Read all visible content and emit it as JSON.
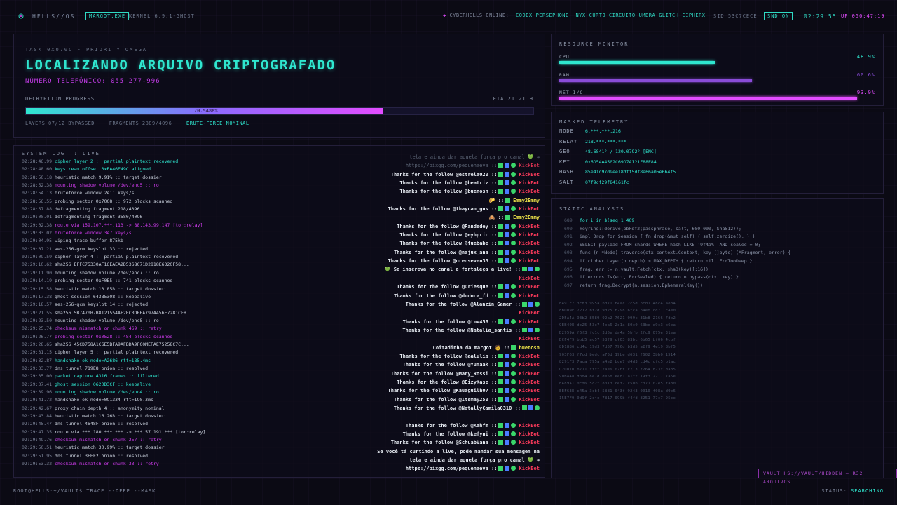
{
  "topbar": {
    "brand": "HELLS//OS",
    "machine": "MARGOT.EXE",
    "kernel": "KERNEL 6.9.1-GHOST",
    "online_label": "CYBERHELLS ONLINE:",
    "online_users": [
      "CODEX",
      "PERSEPHONE_",
      "NYX",
      "CURTO_CIRCUITO",
      "UMBRA",
      "GLITCH",
      "CIPHERX"
    ],
    "sid": "SID 53C7CECE",
    "snd": "SND ON",
    "clock": "02:29:55",
    "uptime": "UP 050:47:19"
  },
  "task": {
    "id": "TASK 0X070C - PRIORITY OMEGA",
    "title": "LOCALIZANDO ARQUIVO CRIPTOGRAFADO",
    "phone": "NÚMERO TELEFÔNICO: 055 277-996",
    "progress_label": "DECRYPTION PROGRESS",
    "eta": "ETA 21.21 H",
    "progress": 0.705,
    "progress_text": "70.5488%",
    "layers": "LAYERS 07/12 BYPASSED",
    "fragments": "FRAGMENTS 2889/4096",
    "bruteforce": "BRUTE-FORCE NOMINAL"
  },
  "syslog": {
    "title": "SYSTEM LOG :: LIVE",
    "lines": [
      {
        "ts": "02:28:46.99",
        "text": "cipher layer 2 :: partial plaintext recovered",
        "color": "cyan"
      },
      {
        "ts": "02:28:48.60",
        "text": "keystream offset 0xEA46E49C aligned",
        "color": "cyan"
      },
      {
        "ts": "02:28:50.18",
        "text": "heuristic match 9.91% :: target dossier",
        "color": "white"
      },
      {
        "ts": "02:28:52.38",
        "text": "mounting shadow volume /dev/enc5 :: ro",
        "color": "mag"
      },
      {
        "ts": "02:28:54.13",
        "text": "bruteforce window 2e11 keys/s",
        "color": "white"
      },
      {
        "ts": "02:28:56.55",
        "text": "probing sector 0x70C8 :: 972 blocks scanned",
        "color": "white"
      },
      {
        "ts": "02:28:57.88",
        "text": "defragmenting fragment 218/4096",
        "color": "white"
      },
      {
        "ts": "02:29:00.01",
        "text": "defragmenting fragment 3580/4096",
        "color": "white"
      },
      {
        "ts": "02:29:02.38",
        "text": "route via 159.107.***.113 -> 88.143.99.147 [tor:relay]",
        "color": "mag"
      },
      {
        "ts": "02:29:03.02",
        "text": "bruteforce window 3e7 keys/s",
        "color": "mag"
      },
      {
        "ts": "02:29:04.95",
        "text": "wiping trace buffer 875kb",
        "color": "white"
      },
      {
        "ts": "02:29:07.21",
        "text": "aes-256-gcm keyslot 33 :: rejected",
        "color": "white"
      },
      {
        "ts": "02:29:09.59",
        "text": "cipher layer 4 :: partial plaintext recovered",
        "color": "white"
      },
      {
        "ts": "02:29:10.62",
        "text": "sha256 EFFC75330AF16EAEA2D5368C71D2818E6D20F58...",
        "color": "white"
      },
      {
        "ts": "02:29:11.90",
        "text": "mounting shadow volume /dev/enc7 :: ro",
        "color": "white"
      },
      {
        "ts": "02:29:14.19",
        "text": "probing sector 0xF0E5 :: 741 blocks scanned",
        "color": "white"
      },
      {
        "ts": "02:29:15.58",
        "text": "heuristic match 13.85% :: target dossier",
        "color": "white"
      },
      {
        "ts": "02:29:17.38",
        "text": "ghost session 64385308 :: keepalive",
        "color": "white"
      },
      {
        "ts": "02:29:18.57",
        "text": "aes-256-gcm keyslot 14 :: rejected",
        "color": "white"
      },
      {
        "ts": "02:29:21.55",
        "text": "sha256 5B7470B7B8121554AF2EC3DBEA797A456F7281CEB...",
        "color": "white"
      },
      {
        "ts": "02:29:23.50",
        "text": "mounting shadow volume /dev/enc8 :: ro",
        "color": "white"
      },
      {
        "ts": "02:29:25.74",
        "text": "checksum mismatch on chunk 469 :: retry",
        "color": "mag"
      },
      {
        "ts": "02:29:26.77",
        "text": "probing sector 0x0528 :: 484 blocks scanned",
        "color": "mag"
      },
      {
        "ts": "02:29:28.65",
        "text": "sha256 45CD758A1C6E5BFA9AFBDA9FC0MEFAE75258C7C...",
        "color": "white"
      },
      {
        "ts": "02:29:31.15",
        "text": "cipher layer 5 :: partial plaintext recovered",
        "color": "white"
      },
      {
        "ts": "02:29:32.87",
        "text": "handshake ok node=A2686 rtt=185.4ms",
        "color": "cyan"
      },
      {
        "ts": "02:29:33.77",
        "text": "dns tunnel 719E8.onion :: resolved",
        "color": "white"
      },
      {
        "ts": "02:29:35.00",
        "text": "packet capture 4316 frames :: filtered",
        "color": "cyan"
      },
      {
        "ts": "02:29:37.41",
        "text": "ghost session 0620D3CF :: keepalive",
        "color": "cyan"
      },
      {
        "ts": "02:29:39.96",
        "text": "mounting shadow volume /dev/enc4 :: ro",
        "color": "cyan"
      },
      {
        "ts": "02:29:41.72",
        "text": "handshake ok node=0C1334 rtt=190.3ms",
        "color": "white"
      },
      {
        "ts": "02:29:42.67",
        "text": "proxy chain depth 4 :: anonymity nominal",
        "color": "white"
      },
      {
        "ts": "02:29:43.84",
        "text": "heuristic match 16.26% :: target dossier",
        "color": "white"
      },
      {
        "ts": "02:29:45.47",
        "text": "dns tunnel 4648F.onion :: resolved",
        "color": "white"
      },
      {
        "ts": "02:29:47.35",
        "text": "route via ***.180.***.*** -> ***.57.191.*** [tor:relay]",
        "color": "white"
      },
      {
        "ts": "02:29:49.76",
        "text": "checksum mismatch on chunk 257 :: retry",
        "color": "mag"
      },
      {
        "ts": "02:29:50.51",
        "text": "heuristic match 30.99% :: target dossier",
        "color": "white"
      },
      {
        "ts": "02:29:51.95",
        "text": "dns tunnel 3FEF2.onion :: resolved",
        "color": "white"
      },
      {
        "ts": "02:29:53.32",
        "text": "checksum mismatch on chunk 33 :: retry",
        "color": "mag"
      }
    ]
  },
  "chat": [
    {
      "text": "tela e ainda dar aquela força pro canal 💚 →",
      "nick": "",
      "faded": true,
      "icons": 0
    },
    {
      "text": "https://pixgg.com/pequenaeva ::",
      "nick": "KickBot",
      "faded": true,
      "icons": 3
    },
    {
      "text": "Thanks for the follow @estrela020 ::",
      "nick": "KickBot",
      "faded": false,
      "icons": 3
    },
    {
      "text": "Thanks for the follow @beatriz ::",
      "nick": "KickBot",
      "faded": false,
      "icons": 3
    },
    {
      "text": "Thanks for the follow @buenosn ::",
      "nick": "KickBot",
      "faded": false,
      "icons": 3
    },
    {
      "text": "🌮 ::",
      "nick": "Emmy2Emmy",
      "faded": false,
      "icons": 1,
      "nickColor": "yel"
    },
    {
      "text": "Thanks for the follow @thaynan_gus ::",
      "nick": "KickBot",
      "faded": false,
      "icons": 3
    },
    {
      "text": "🙈 ::",
      "nick": "Emmy2Emmy",
      "faded": false,
      "icons": 1,
      "nickColor": "yel"
    },
    {
      "text": "Thanks for the follow @Pandedey ::",
      "nick": "KickBot",
      "faded": false,
      "icons": 3
    },
    {
      "text": "Thanks for the follow @eyhpric ::",
      "nick": "KickBot",
      "faded": false,
      "icons": 3
    },
    {
      "text": "Thanks for the follow @fuebabe ::",
      "nick": "KickBot",
      "faded": false,
      "icons": 3
    },
    {
      "text": "Thanks for the follow @najux_ana ::",
      "nick": "KickBot",
      "faded": false,
      "icons": 3
    },
    {
      "text": "Thanks for the follow @oreoseven33 ::",
      "nick": "KickBot",
      "faded": false,
      "icons": 3
    },
    {
      "text": "💚 Se inscreva no canal e fortaleça a live! ::",
      "nick": "",
      "faded": false,
      "icons": 3
    },
    {
      "text": "",
      "nick": "KickBot",
      "faded": false,
      "icons": 0
    },
    {
      "text": "Thanks for the follow @Driesque ::",
      "nick": "KickBot",
      "faded": false,
      "icons": 3
    },
    {
      "text": "Thanks for the follow @dudoca_fd ::",
      "nick": "KickBot",
      "faded": false,
      "icons": 3
    },
    {
      "text": "Thanks for the follow @Alanzin_Gamer ::",
      "nick": "",
      "faded": false,
      "icons": 3
    },
    {
      "text": "",
      "nick": "KickBot",
      "faded": false,
      "icons": 0
    },
    {
      "text": "Thanks for the follow @tmv456 ::",
      "nick": "KickBot",
      "faded": false,
      "icons": 3
    },
    {
      "text": "Thanks for the follow @Natalia_santis ::",
      "nick": "",
      "faded": false,
      "icons": 3
    },
    {
      "text": "",
      "nick": "KickBot",
      "faded": false,
      "icons": 0
    },
    {
      "text": "Coitadinha da margot 🧑 ::",
      "nick": "buenosn",
      "faded": false,
      "icons": 1,
      "nickColor": "yel"
    },
    {
      "text": "Thanks for the follow @aalulia ::",
      "nick": "KickBot",
      "faded": false,
      "icons": 3
    },
    {
      "text": "Thanks for the follow @Yumaak ::",
      "nick": "KickBot",
      "faded": false,
      "icons": 3
    },
    {
      "text": "Thanks for the follow @Mary_Rossi ::",
      "nick": "KickBot",
      "faded": false,
      "icons": 3
    },
    {
      "text": "Thanks for the follow @EizyKase ::",
      "nick": "KickBot",
      "faded": false,
      "icons": 3
    },
    {
      "text": "Thanks for the follow @Kauaguilh07 ::",
      "nick": "KickBot",
      "faded": false,
      "icons": 3
    },
    {
      "text": "Thanks for the follow @Itsmay250 ::",
      "nick": "KickBot",
      "faded": false,
      "icons": 3
    },
    {
      "text": "Thanks for the follow @NatallyCamila0310 ::",
      "nick": "",
      "faded": false,
      "icons": 3
    },
    {
      "text": "",
      "nick": "",
      "faded": false,
      "icons": 0
    },
    {
      "text": "Thanks for the follow @Kahfm ::",
      "nick": "KickBot",
      "faded": false,
      "icons": 3
    },
    {
      "text": "Thanks for the follow @kefyni ::",
      "nick": "KickBot",
      "faded": false,
      "icons": 3
    },
    {
      "text": "Thanks for the follow @SchuabVana ::",
      "nick": "KickBot",
      "faded": false,
      "icons": 3
    },
    {
      "text": "Se você tá curtindo a live, pode mandar sua mensagem na",
      "nick": "",
      "faded": false,
      "icons": 0
    },
    {
      "text": "tela e ainda dar aquela força pro canal 💚 →",
      "nick": "",
      "faded": false,
      "icons": 0
    },
    {
      "text": "https://pixgg.com/pequenaeva ::",
      "nick": "KickBot",
      "faded": false,
      "icons": 3
    }
  ],
  "resource_monitor": {
    "title": "RESOURCE MONITOR",
    "items": [
      {
        "label": "CPU",
        "value": "48.9%",
        "fraction": 0.489,
        "color": "#2fe6cf"
      },
      {
        "label": "RAM",
        "value": "60.6%",
        "fraction": 0.606,
        "color": "#8a4cd8"
      },
      {
        "label": "NET I/O",
        "value": "93.9%",
        "fraction": 0.939,
        "color": "#e34cff"
      }
    ]
  },
  "telemetry": {
    "title": "MASKED TELEMETRY",
    "rows": [
      {
        "key": "NODE",
        "value": "6.***.***.216"
      },
      {
        "key": "RELAY",
        "value": "218.***.***.***"
      },
      {
        "key": "GEO",
        "value": "48.6841° / 120.0792° [ENC]"
      },
      {
        "key": "KEY",
        "value": "0x6D54A4502C69D7A121F88E84"
      },
      {
        "key": "HASH",
        "value": "85e41d97d9ee18dff5df8e66a05e664f5"
      },
      {
        "key": "SALT",
        "value": "07f9cf29f84161fc"
      }
    ]
  },
  "static_analysis": {
    "title": "STATIC ANALYSIS",
    "code": [
      {
        "ln": "689",
        "text": "for i in $(seq 1 409",
        "hl": true
      },
      {
        "ln": "690",
        "text": "keyring::derive(pbkdf2(passphrase, salt, 600_000, Sha512));",
        "hl": false
      },
      {
        "ln": "691",
        "text": "impl Drop for Session { fn drop(&mut self) { self.zeroize(); } }",
        "hl": false
      },
      {
        "ln": "692",
        "text": "SELECT payload FROM shards WHERE hash LIKE '9f4a%' AND sealed = 0;",
        "hl": false
      },
      {
        "ln": "693",
        "text": "func (n *Node) traverse(ctx context.Context, key []byte) (*Fragment, error) {",
        "hl": false
      },
      {
        "ln": "694",
        "text": "if cipher.Layer(n.depth) > MAX_DEPTH { return nil, ErrTooDeep }",
        "hl": false
      },
      {
        "ln": "695",
        "text": "frag, err := n.vault.Fetch(ctx, sha3(key)[:16])",
        "hl": false
      },
      {
        "ln": "696",
        "text": "if errors.Is(err, ErrSealed) { return n.bypass(ctx, key) }",
        "hl": false
      },
      {
        "ln": "697",
        "text": "return frag.Decrypt(n.session.EphemeralKey())",
        "hl": false
      }
    ],
    "hex": [
      "E491E7 3F83 995a bd71 b4ac 2c5d bcd1 48c4 ae84",
      "8BD09E 7212 bf2d 9d25 b298 6fca b4ef cd71 c4e0",
      "2D5A4A 93b2 8589 92a2 7621 099c 31b8 2166 7db2",
      "9EB40E dc25 53c7 4ba6 2c1a 80c0 63be e9c3 b6ea",
      "D2959A f6f3 fc1c 3d5e da4a 5bfb 2fc9 075e 31ea",
      "DCF4F9 bbb5 ac57 58f9 cf03 83bc 6b65 bf06 4cbf",
      "8D1886 cd4c 19d3 7d57 796d b3d5 a2f9 4e19 8bf5",
      "903F63 f7cd bedc a75d 19be d631 f602 3bb0 1514",
      "8291F3 7aca 795a a4e2 bce7 d4d3 cd4c cfc5 b1ac",
      "C2DD7D b771 ffff 2ae6 07bf c713 f264 823f da85",
      "90BA48 dbd4 8e7d de5b ee81 a1ff 19f3 2217 7a5e",
      "EA89A1 0cf6 5c2f 8013 cef2 c50b c371 07e5 fa80",
      "EEF63E c45a 3cb4 5881 043f 9243 0010 f08a d9e6",
      "15E7F9 0d9f 2c4e 7817 099b f4fd 8251 77c7 95cc"
    ]
  },
  "vault": "VAULT HS://VAULT/HIDDEN — R32 ARQUIVOS",
  "bottom": {
    "cmd": "ROOT@HELLS:~/VAULT$ TRACE --DEEP --MASK",
    "status_label": "STATUS:",
    "status_value": "SEARCHING"
  }
}
